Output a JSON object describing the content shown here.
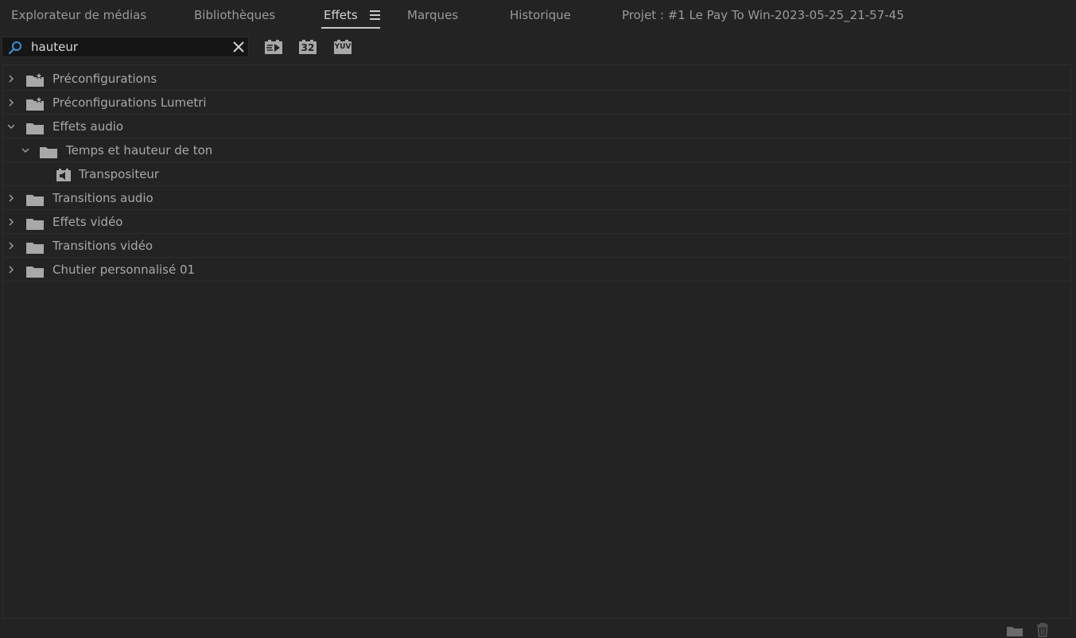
{
  "tabs": [
    {
      "label": "Explorateur de médias",
      "active": false
    },
    {
      "label": "Bibliothèques",
      "active": false
    },
    {
      "label": "Effets",
      "active": true
    },
    {
      "label": "Marques",
      "active": false
    },
    {
      "label": "Historique",
      "active": false
    }
  ],
  "project_title": "Projet : #1 Le Pay To Win-2023-05-25_21-57-45",
  "search": {
    "value": "hauteur",
    "placeholder": ""
  },
  "toolbar": {
    "accelerated_icon": "accelerated-effects-icon",
    "bit32_label": "32",
    "yuv_label": "YUV"
  },
  "tree": [
    {
      "label": "Préconfigurations",
      "icon": "preset-folder-icon",
      "expanded": false,
      "depth": 0
    },
    {
      "label": "Préconfigurations Lumetri",
      "icon": "preset-folder-icon",
      "expanded": false,
      "depth": 0
    },
    {
      "label": "Effets audio",
      "icon": "folder-icon",
      "expanded": true,
      "depth": 0
    },
    {
      "label": "Temps et hauteur de ton",
      "icon": "folder-icon",
      "expanded": true,
      "depth": 1
    },
    {
      "label": "Transpositeur",
      "icon": "audio-effect-icon",
      "expanded": null,
      "depth": 2
    },
    {
      "label": "Transitions audio",
      "icon": "folder-icon",
      "expanded": false,
      "depth": 0
    },
    {
      "label": "Effets vidéo",
      "icon": "folder-icon",
      "expanded": false,
      "depth": 0
    },
    {
      "label": "Transitions vidéo",
      "icon": "folder-icon",
      "expanded": false,
      "depth": 0
    },
    {
      "label": "Chutier personnalisé 01",
      "icon": "folder-icon",
      "expanded": false,
      "depth": 0
    }
  ],
  "colors": {
    "background": "#232323",
    "search_icon": "#3b8fd9",
    "text": "#a8a8a8"
  }
}
